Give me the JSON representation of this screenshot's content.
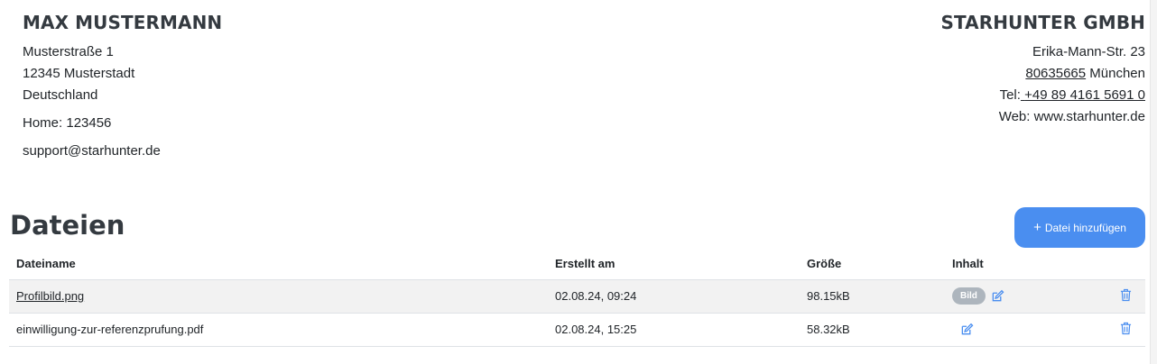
{
  "person": {
    "name": "MAX MUSTERMANN",
    "street": "Musterstraße 1",
    "city": "12345 Musterstadt",
    "country": "Deutschland",
    "phone": "Home: 123456",
    "email": "support@starhunter.de"
  },
  "company": {
    "name": "STARHUNTER GMBH",
    "street": "Erika-Mann-Str. 23",
    "zip": "80635665",
    "city": "München",
    "tel_label": "Tel:",
    "tel_number": "+49 89 4161 5691 0",
    "web": "Web: www.starhunter.de"
  },
  "files": {
    "heading": "Dateien",
    "add_button_label": "Datei hinzufügen",
    "add_button_icon": "plus-icon",
    "columns": [
      "Dateiname",
      "Erstellt am",
      "Größe",
      "Inhalt"
    ],
    "rows": [
      {
        "name": "Profilbild.png",
        "created": "02.08.24, 09:24",
        "size": "98.15kB",
        "badge": "Bild"
      },
      {
        "name": "einwilligung-zur-referenzprufung.pdf",
        "created": "02.08.24, 15:25",
        "size": "58.32kB",
        "badge": ""
      }
    ]
  },
  "colors": {
    "accent": "#4a8ef0",
    "badge": "#adb5bd",
    "row_stripe": "#f2f2f2"
  },
  "icons": {
    "edit": "edit-icon",
    "delete": "trash-icon"
  }
}
